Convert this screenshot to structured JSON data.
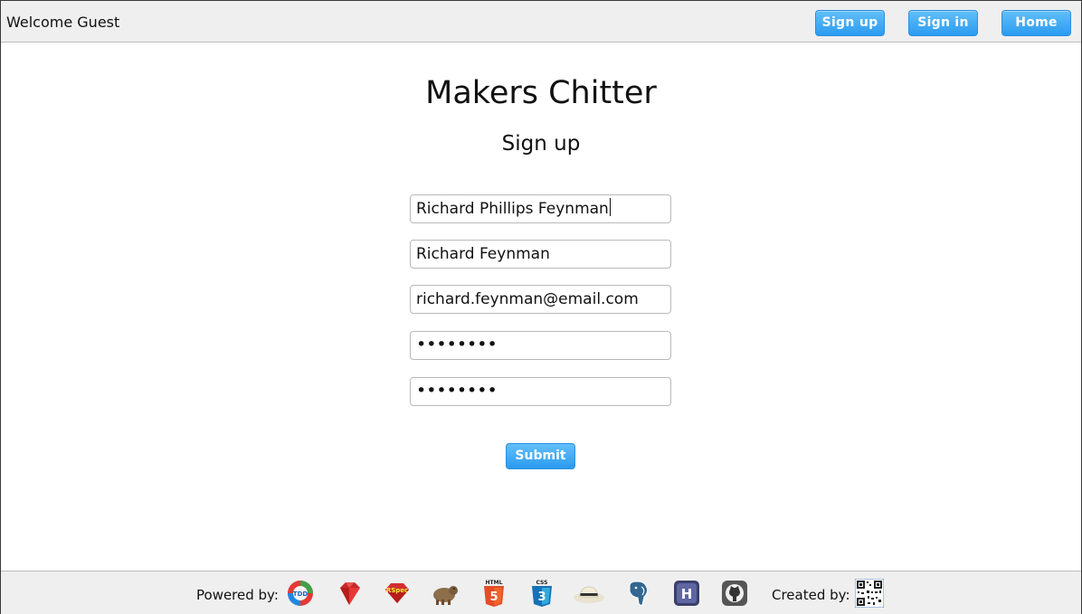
{
  "header": {
    "welcome_text": "Welcome Guest",
    "nav": [
      {
        "label": "Sign up"
      },
      {
        "label": "Sign in"
      },
      {
        "label": "Home"
      }
    ]
  },
  "main": {
    "title": "Makers Chitter",
    "subtitle": "Sign up",
    "fields": {
      "name": "Richard Phillips Feynman",
      "username": "Richard Feynman",
      "email": "richard.feynman@email.com",
      "password": "••••••••",
      "password_confirmation": "••••••••"
    },
    "submit_label": "Submit"
  },
  "footer": {
    "powered_by": "Powered by:",
    "created_by": "Created by:",
    "logos": [
      "tdd-icon",
      "ruby-icon",
      "rspec-icon",
      "capybara-icon",
      "html5-icon",
      "css3-icon",
      "sinatra-hat-icon",
      "postgresql-icon",
      "heroku-icon",
      "github-icon"
    ],
    "html5_text": "HTML",
    "css3_text": "CSS",
    "tdd_text": "TDD",
    "rspec_text": "RSpec",
    "heroku_text": "H",
    "button_accent": "#2a9bf0"
  }
}
